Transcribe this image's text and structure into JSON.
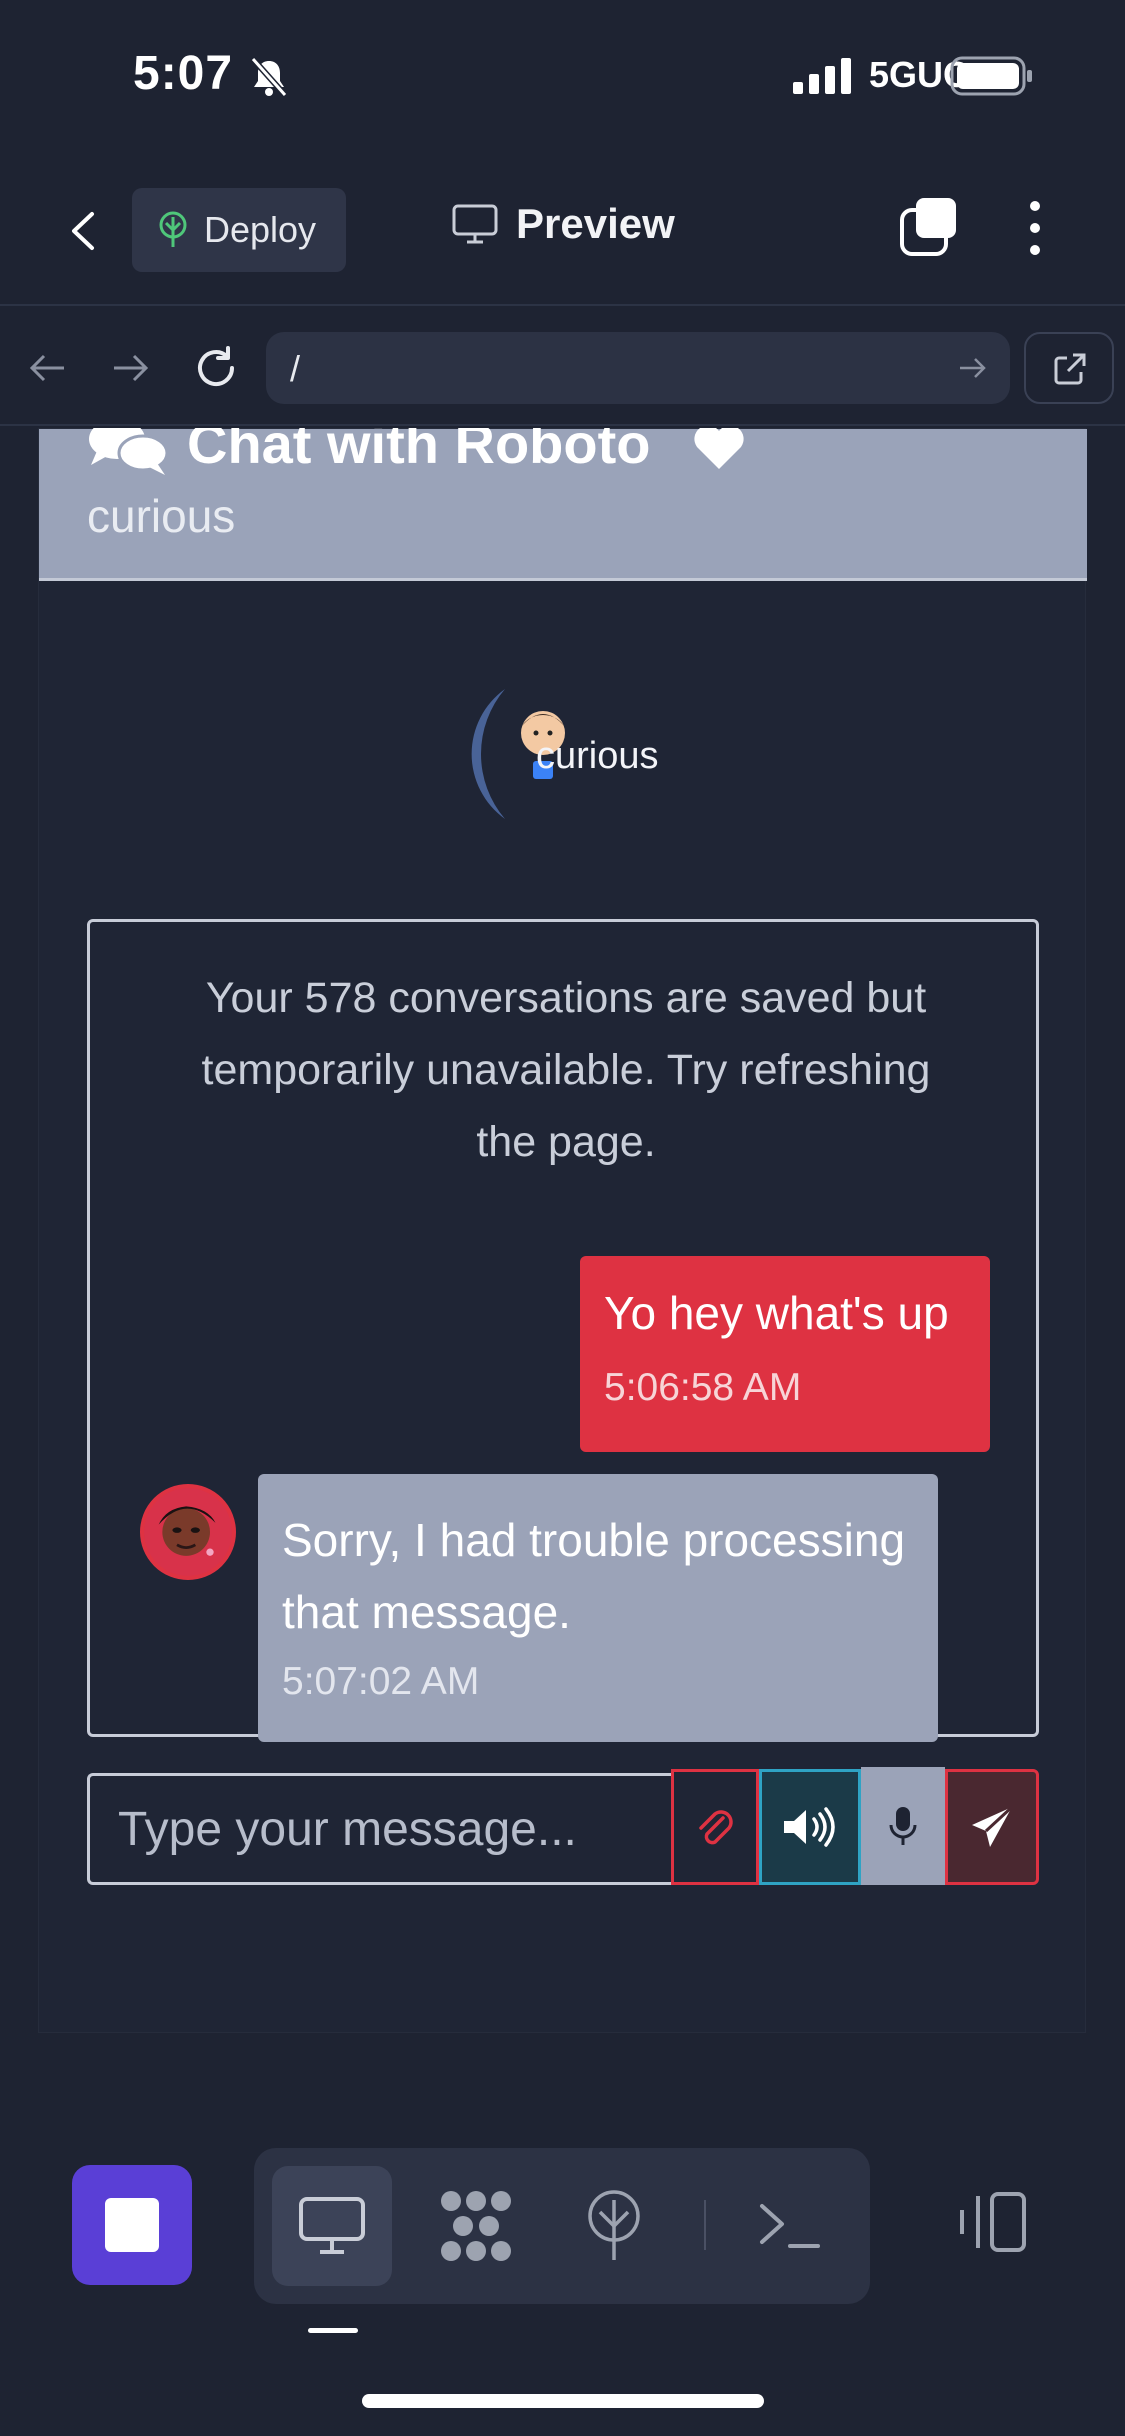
{
  "status_bar": {
    "time": "5:07",
    "network": "5GUC"
  },
  "top_bar": {
    "deploy_label": "Deploy",
    "preview_label": "Preview"
  },
  "url_bar": {
    "url": "/"
  },
  "chat": {
    "title": "Chat with Roboto",
    "mood": "curious",
    "orb_label": "curious",
    "notice": "Your 578 conversations are saved but temporarily unavailable. Try refreshing the page.",
    "messages": [
      {
        "sender": "user",
        "text": "Yo hey what's up",
        "time": "5:06:58 AM"
      },
      {
        "sender": "bot",
        "text": "Sorry, I had trouble processing that message.",
        "time": "5:07:02 AM"
      }
    ],
    "input_placeholder": "Type your message..."
  },
  "colors": {
    "background": "#1e2332",
    "header": "#9aa3b9",
    "user_bubble": "#de3242",
    "bot_bubble": "#9ba3b8",
    "accent_purple": "#5a3fd6",
    "voice_accent": "#2fa3c4"
  },
  "icons": [
    "bell-slash-icon",
    "signal-icon",
    "battery-icon",
    "back-chevron-icon",
    "deploy-icon",
    "monitor-icon",
    "tabs-icon",
    "more-vertical-icon",
    "arrow-left-icon",
    "arrow-right-icon",
    "reload-icon",
    "open-external-icon",
    "chat-bubbles-icon",
    "heart-icon",
    "paperclip-icon",
    "speaker-icon",
    "microphone-icon",
    "send-icon",
    "stop-icon",
    "desktop-icon",
    "blocks-icon",
    "deploy-tree-icon",
    "terminal-icon",
    "panel-toggle-icon"
  ]
}
